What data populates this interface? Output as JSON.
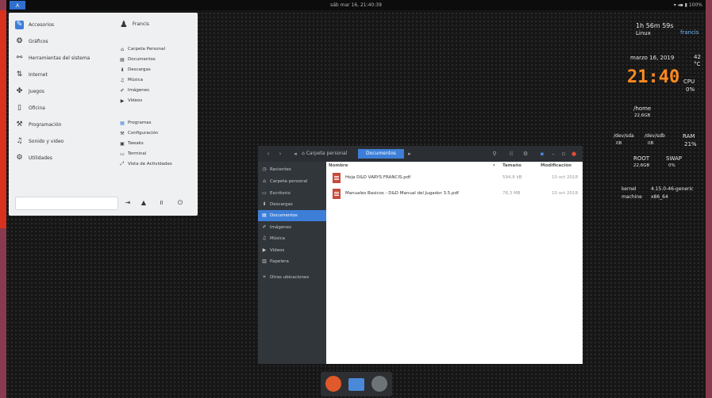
{
  "topbar": {
    "clock": "sáb mar 16, 21:40:39",
    "activities_icon": "elementary-logo-icon",
    "tray": "▾ ◂▪ ▮ 100%"
  },
  "menu": {
    "user": "Francis",
    "categories": [
      "Accesorios",
      "Gráficos",
      "Herramientas del sistema",
      "Internet",
      "Juegos",
      "Oficina",
      "Programación",
      "Sonido y video",
      "Utilidades"
    ],
    "places": [
      "Carpeta Personal",
      "Documentos",
      "Descargas",
      "Música",
      "Imágenes",
      "Videos"
    ],
    "system": [
      "Programas",
      "Configuración",
      "Tweaks",
      "Terminal",
      "Vista de Actividades"
    ]
  },
  "conky": {
    "uptime": "1h 56m 59s",
    "user": "francis",
    "os": "Linux",
    "date": "marzo 16, 2019",
    "time": "21:40",
    "temp": "42",
    "temp_unit": "°C",
    "cpu_label": "CPU",
    "cpu_val": "0%",
    "home_label": "/home",
    "home_val": "22,6GB",
    "dev1_label": "/dev/sda",
    "dev1_val": "0B",
    "dev2_label": "/dev/sdb",
    "dev2_val": "0B",
    "ram_label": "RAM",
    "ram_val": "21%",
    "root_label": "ROOT",
    "root_val": "22,6GB",
    "swap_label": "SWAP",
    "swap_val": "0%",
    "kernel_label": "kernel",
    "kernel_val": "4.15.0-46-generic",
    "machine_label": "machine",
    "machine_val": "x86_64"
  },
  "filemanager": {
    "crumb_home": "Carpeta personal",
    "crumb_current": "Documentos",
    "sidebar": [
      "Recientes",
      "Carpeta personal",
      "Escritorio",
      "Descargas",
      "Documentos",
      "Imágenes",
      "Música",
      "Videos",
      "Papelera",
      "Otras ubicaciones"
    ],
    "columns": {
      "name": "Nombre",
      "size": "Tamaño",
      "modified": "Modificación"
    },
    "files": [
      {
        "name": "Hoja D&D VARYS FRANCIS.pdf",
        "size": "594,8 kB",
        "date": "10 oct 2018"
      },
      {
        "name": "Manuales Basicos - D&D Manual del Jugador 3.5.pdf",
        "size": "78,3 MB",
        "date": "10 oct 2018"
      }
    ]
  },
  "colors": {
    "accent": "#3d7fd8",
    "clock": "#ff8a1f",
    "red_strip": "#d8321f"
  }
}
